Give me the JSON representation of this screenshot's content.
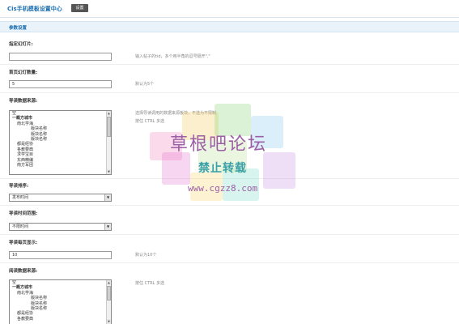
{
  "header": {
    "title": "Cis手机模板设置中心",
    "button_label": "设置"
  },
  "section": {
    "title": "参数设置"
  },
  "fields": {
    "slides": {
      "label": "指定幻灯片:",
      "value": "",
      "hint": "输入帖子的tid，多个用半角的逗号隔开\",\""
    },
    "slide_count": {
      "label": "首页幻灯数量:",
      "value": "5",
      "hint": "默认为5个"
    },
    "guide_source": {
      "label": "导读数据来源:",
      "hint_line1": "选择导读调用的数据来源板块，不选为不限制",
      "hint_line2": "按住 CTRL 多选",
      "items": [
        "空",
        "一概方城市",
        "南北学海",
        "版块名称",
        "版块名称",
        "版块名称",
        "都是经协",
        "各教要典",
        "求学宝目",
        "东西精编",
        "南方军团"
      ]
    },
    "guide_sort": {
      "label": "导读排序:",
      "value": "发布时间"
    },
    "guide_time": {
      "label": "导读时间范围:",
      "value": "不限时间"
    },
    "guide_per_page": {
      "label": "导读每页显示:",
      "value": "10",
      "hint": "默认为10个"
    },
    "read_source": {
      "label": "阅读数据来源:",
      "hint": "按住 CTRL 多选",
      "items": [
        "空",
        "一概方城市",
        "南北学海",
        "版块名称",
        "版块名称",
        "版块名称",
        "都是经协",
        "各教要典"
      ]
    }
  },
  "watermark": {
    "line1": "草根吧论坛",
    "line2": "禁止转载",
    "line3": "www.cgzz8.com"
  },
  "colors": {
    "accent": "#1b6fb0",
    "section_bg": "#eaf3fa"
  }
}
